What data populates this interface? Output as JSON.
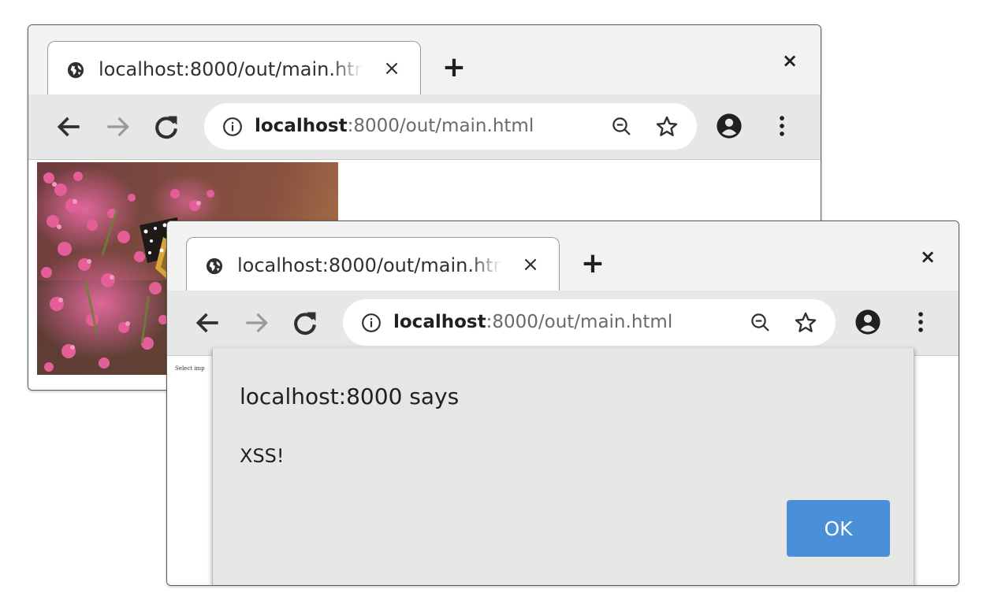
{
  "windows": {
    "back": {
      "tab_title": "localhost:8000/out/main.html",
      "url_host": "localhost",
      "url_rest": ":8000/out/main.html"
    },
    "front": {
      "tab_title": "localhost:8000/out/main.html",
      "url_host": "localhost",
      "url_rest": ":8000/out/main.html",
      "page_text": "Select imp"
    }
  },
  "icons": {
    "tab_close": "×",
    "new_tab": "+",
    "window_close": "×"
  },
  "alert": {
    "title": "localhost:8000 says",
    "message": "XSS!",
    "ok_label": "OK"
  },
  "colors": {
    "ok_button": "#4a90d9",
    "alert_background": "#e6e6e5",
    "toolbar": "#e7e7e7",
    "titlebar": "#f2f2f2"
  }
}
